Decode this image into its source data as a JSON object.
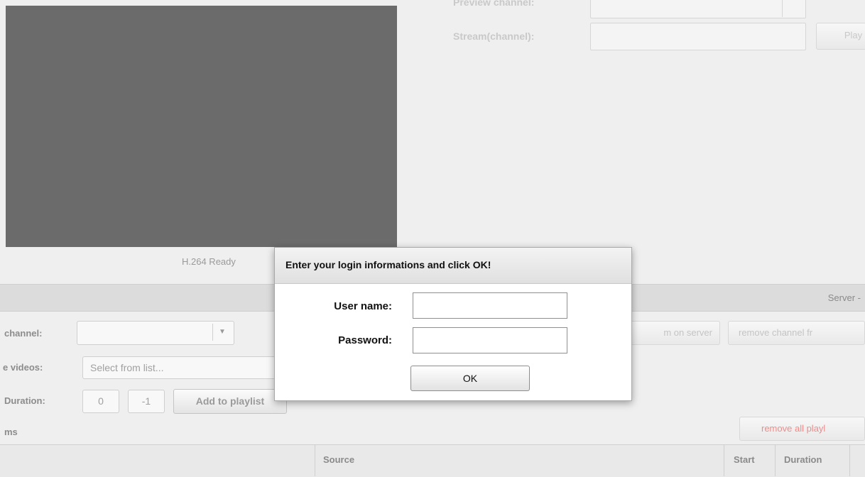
{
  "video": {
    "status_text": "H.264 Ready"
  },
  "stream_panel": {
    "preview_label": "Preview channel:",
    "stream_label": "Stream(channel):",
    "play_button_label": "Play"
  },
  "section_bar": {
    "server_label": "Server -"
  },
  "form": {
    "channel_label": "channel:",
    "videos_label": "e videos:",
    "videos_placeholder": "Select from list...",
    "duration_label": "Duration:",
    "start_value": "0",
    "duration_value": "-1",
    "add_playlist_label": "Add to playlist",
    "items_label": "ms",
    "stream_on_server_label": "m on server",
    "remove_channel_label": "remove channel fr",
    "remove_all_label": "remove all playl"
  },
  "table": {
    "headers": {
      "source": "Source",
      "start": "Start",
      "duration": "Duration"
    }
  },
  "dialog": {
    "title": "Enter your login informations and click OK!",
    "username_label": "User name:",
    "password_label": "Password:",
    "username_value": "",
    "password_value": "",
    "ok_label": "OK"
  },
  "colors": {
    "video_bg": "#6b6b6b",
    "remove_all_text": "#f08a8a",
    "dialog_title_bg": "#e6e6e6"
  }
}
